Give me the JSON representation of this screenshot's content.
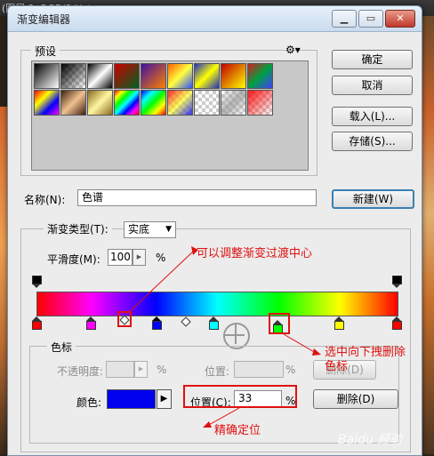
{
  "background": {
    "window_tab": "(图层 2, RGB/8#) *"
  },
  "dialog": {
    "title": "渐变编辑器",
    "window_buttons": [
      "▁",
      "▭",
      "✕"
    ],
    "presets": {
      "legend": "预设",
      "menu_icon": "gear-icon"
    },
    "buttons": {
      "ok": "确定",
      "cancel": "取消",
      "load": "载入(L)...",
      "save": "存储(S)...",
      "new": "新建(W)"
    },
    "name": {
      "label": "名称(N):",
      "value": "色谱"
    },
    "gradient_type": {
      "label": "渐变类型(T):",
      "value": "实底"
    },
    "smoothness": {
      "label": "平滑度(M):",
      "value": "100",
      "unit": "%"
    },
    "stops": {
      "legend": "色标",
      "opacity_label": "不透明度:",
      "opacity_unit": "%",
      "location_label_top": "位置:",
      "location_unit_top": "%",
      "delete_label_top": "删除(D)",
      "color_label": "颜色:",
      "color_value": "#0000ff",
      "location_label": "位置(C):",
      "location_value": "33",
      "location_unit": "%",
      "delete_label": "删除(D)"
    }
  },
  "colors": {
    "stops": [
      "#ff0000",
      "#ff00ff",
      "#0000ff",
      "#00ffff",
      "#00ff00",
      "#ffff00",
      "#ff0000"
    ],
    "accent": "#e01010"
  },
  "annotations": {
    "midpoint_note": "可以调整渐变过渡中心",
    "drag_note": "选中向下拽删除色标",
    "precise_note": "精确定位"
  },
  "watermark": "Baidu 经验"
}
